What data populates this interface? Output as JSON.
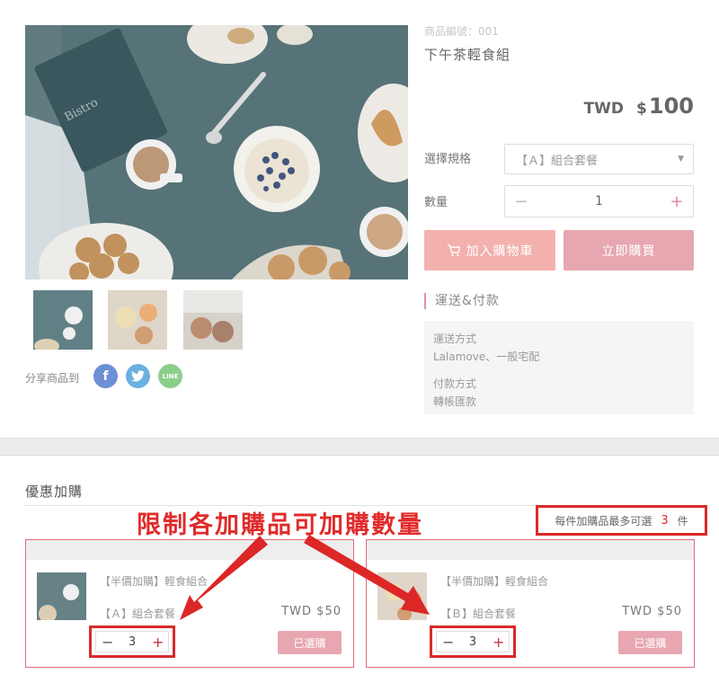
{
  "product": {
    "number": "商品編號：001",
    "name": "下午茶輕食組",
    "currency": "TWD",
    "dollar_sign": "$",
    "price": "100",
    "spec_label": "選擇規格",
    "spec_value": "【Ａ】組合套餐",
    "qty_label": "數量",
    "qty_value": "1",
    "add_to_cart": "加入購物車",
    "buy_now": "立即購買",
    "share_label": "分享商品到"
  },
  "shipping": {
    "title": "運送&付款",
    "method_label": "運送方式",
    "method_value": "Lalamove、一般宅配",
    "payment_label": "付款方式",
    "payment_value": "轉帳匯款"
  },
  "addons": {
    "section_title": "優惠加購",
    "annotation": "限制各加購品可加購數量",
    "limit_prefix": "每件加購品最多可選",
    "limit_count": "3",
    "limit_suffix": "件",
    "items": [
      {
        "name": "【半價加購】輕食組合",
        "spec": "【Ａ】組合套餐",
        "price": "TWD  $50",
        "qty": "3",
        "selected_label": "已選購"
      },
      {
        "name": "【半價加購】輕食組合",
        "spec": "【Ｂ】組合套餐",
        "price": "TWD  $50",
        "qty": "3",
        "selected_label": "已選購"
      }
    ]
  },
  "icons": {
    "cart": "cart-icon",
    "facebook": "facebook-icon",
    "twitter": "twitter-icon",
    "line": "line-icon",
    "dropdown": "chevron-down-icon"
  },
  "colors": {
    "accent_pink": "#e7a7b0",
    "cart_button": "#f2b1ad",
    "annotation_red": "#e02b2b"
  }
}
